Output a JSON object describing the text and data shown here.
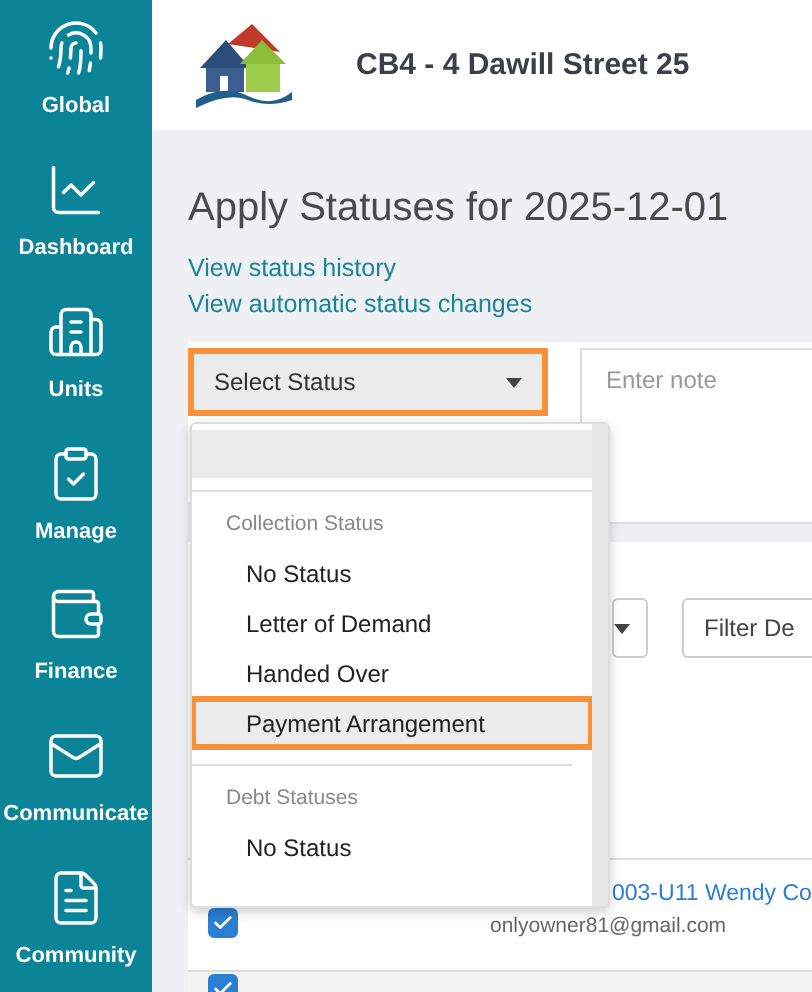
{
  "sidebar": {
    "items": [
      {
        "label": "Global",
        "kind": "fingerprint"
      },
      {
        "label": "Dashboard",
        "kind": "chart"
      },
      {
        "label": "Units",
        "kind": "units"
      },
      {
        "label": "Manage",
        "kind": "clipboard"
      },
      {
        "label": "Finance",
        "kind": "wallet"
      },
      {
        "label": "Communicate",
        "kind": "mail"
      },
      {
        "label": "Community",
        "kind": "document"
      }
    ]
  },
  "header": {
    "title": "CB4 - 4 Dawill Street 25"
  },
  "page": {
    "title": "Apply Statuses for 2025-12-01",
    "links": [
      "View status history",
      "View automatic status changes"
    ]
  },
  "status_select": {
    "value": "Select Status",
    "highlighted": true
  },
  "note": {
    "placeholder": "Enter note"
  },
  "filter": {
    "placeholder": "Filter De"
  },
  "dropdown": {
    "groups": [
      {
        "label": "Collection Status",
        "options": [
          {
            "label": "No Status",
            "highlighted": false
          },
          {
            "label": "Letter of Demand",
            "highlighted": false
          },
          {
            "label": "Handed Over",
            "highlighted": false
          },
          {
            "label": "Payment Arrangement",
            "highlighted": true
          }
        ]
      },
      {
        "label": "Debt Statuses",
        "options": [
          {
            "label": "No Status",
            "highlighted": false
          }
        ]
      }
    ]
  },
  "rows": [
    {
      "checked": true,
      "name": "003-U11 Wendy Co",
      "email": "onlyowner81@gmail.com"
    },
    {
      "checked": true
    }
  ]
}
